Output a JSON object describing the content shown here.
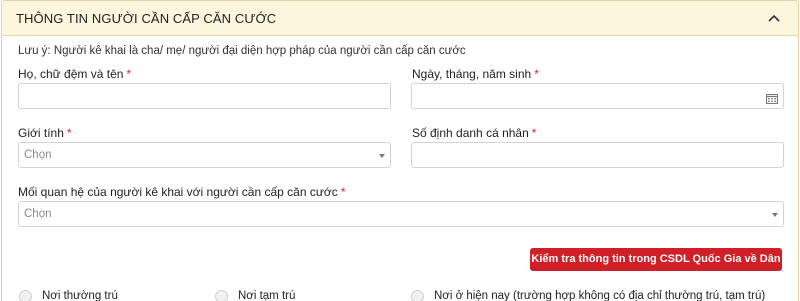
{
  "section": {
    "title": "THÔNG TIN NGƯỜI CẦN CẤP CĂN CƯỚC",
    "note": "Lưu ý: Người kê khai là cha/ mẹ/ người đại diện hợp pháp của người cần cấp căn cước"
  },
  "fields": {
    "full_name": {
      "label": "Họ, chữ đệm và tên",
      "required": "*",
      "value": ""
    },
    "dob": {
      "label": "Ngày, tháng, năm sinh",
      "required": "*",
      "value": ""
    },
    "gender": {
      "label": "Giới tính",
      "required": "*",
      "placeholder": "Chọn"
    },
    "id_number": {
      "label": "Số định danh cá nhân",
      "required": "*",
      "value": ""
    },
    "relationship": {
      "label": "Mối quan hệ của người kê khai với người cần cấp căn cước",
      "required": "*",
      "placeholder": "Chọn"
    }
  },
  "actions": {
    "check_button": "Kiểm tra thông tin trong CSDL Quốc Gia về Dân cư"
  },
  "residence_options": [
    {
      "label": "Nơi thường trú",
      "checked": false
    },
    {
      "label": "Nơi tạm trú",
      "checked": false
    },
    {
      "label": "Nơi ở hiện nay (trường hợp không có địa chỉ thường trú, tạm trú)",
      "checked": false
    }
  ],
  "colors": {
    "header_bg": "#fcf6de",
    "accent_red": "#d11f28",
    "required_red": "#d8232a"
  },
  "icons": {
    "collapse": "chevron-up-icon",
    "date": "calendar-icon",
    "select": "caret-down-icon"
  }
}
